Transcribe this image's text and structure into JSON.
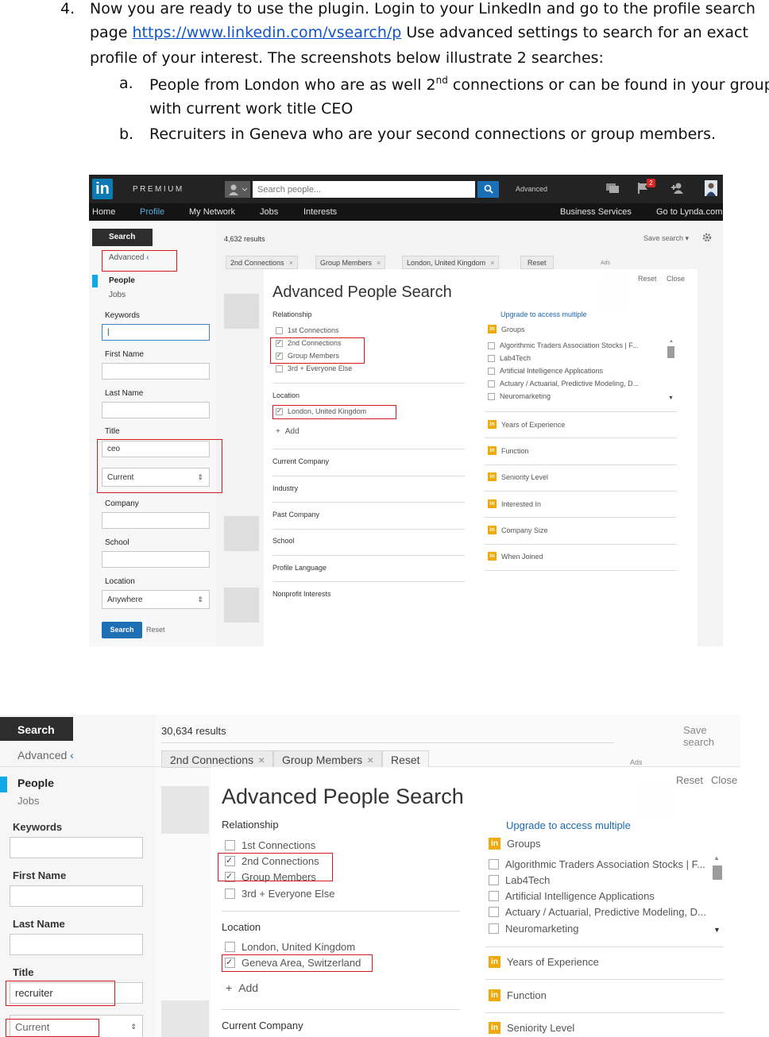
{
  "doc": {
    "item4_num": "4.",
    "item4_line1": "Now you are ready to use the plugin. Login to your LinkedIn and go to the profile search",
    "item4_line2_pre": "page ",
    "item4_link": "https://www.linkedin.com/vsearch/p",
    "item4_line2_post": "  Use advanced settings to search for an exact",
    "item4_line3": "profile of your interest. The screenshots below illustrate 2 searches:",
    "a_label": "a.",
    "a_line1_pre": "People from London who are as well 2",
    "a_sup": "nd",
    "a_line1_post": " connections or can be found in your groups",
    "a_line2": "with current work title CEO",
    "b_label": "b.",
    "b_line1": "Recruiters in Geneva who are your second connections or group members."
  },
  "shot1": {
    "topbar": {
      "logo": "in",
      "premium": "PREMIUM",
      "search_placeholder": "Search people...",
      "advanced": "Advanced",
      "notif_count": "2"
    },
    "nav": [
      "Home",
      "Profile",
      "My Network",
      "Jobs",
      "Interests",
      "Business Services",
      "Go to Lynda.com"
    ],
    "left": {
      "search_tab": "Search",
      "advanced": "Advanced",
      "advanced_chev": "‹",
      "people": "People",
      "jobs": "Jobs",
      "keywords": "Keywords",
      "keywords_value": "|",
      "first_name": "First Name",
      "last_name": "Last Name",
      "title": "Title",
      "title_value": "ceo",
      "title_scope": "Current",
      "company": "Company",
      "school": "School",
      "location": "Location",
      "location_value": "Anywhere",
      "search_btn": "Search",
      "reset": "Reset"
    },
    "results": {
      "count": "4,632 results",
      "save_search": "Save search",
      "filters": [
        "2nd Connections",
        "Group Members",
        "London, United Kingdom"
      ],
      "reset": "Reset",
      "ads": "Ads"
    },
    "modal": {
      "reset": "Reset",
      "close": "Close",
      "title": "Advanced People Search",
      "relationship": "Relationship",
      "rel_options": [
        {
          "label": "1st Connections",
          "checked": false
        },
        {
          "label": "2nd Connections",
          "checked": true
        },
        {
          "label": "Group Members",
          "checked": true
        },
        {
          "label": "3rd + Everyone Else",
          "checked": false
        }
      ],
      "location": "Location",
      "location_option": "London, United Kingdom",
      "add": "Add",
      "left_sections": [
        "Current Company",
        "Industry",
        "Past Company",
        "School",
        "Profile Language",
        "Nonprofit Interests"
      ],
      "upgrade": "Upgrade to access multiple",
      "groups": "Groups",
      "group_options": [
        "Algorithmic Traders Association Stocks | F...",
        "Lab4Tech",
        "Artificial Intelligence Applications",
        "Actuary / Actuarial, Predictive Modeling, D...",
        "Neuromarketing"
      ],
      "right_sections": [
        "Years of Experience",
        "Function",
        "Seniority Level",
        "Interested In",
        "Company Size",
        "When Joined"
      ]
    }
  },
  "shot2": {
    "left": {
      "search_tab": "Search",
      "advanced": "Advanced",
      "advanced_chev": "‹",
      "people": "People",
      "jobs": "Jobs",
      "keywords": "Keywords",
      "first_name": "First Name",
      "last_name": "Last Name",
      "title": "Title",
      "title_value": "recruiter",
      "title_scope": "Current"
    },
    "results": {
      "count": "30,634 results",
      "save_search": "Save search",
      "filters": [
        "2nd Connections",
        "Group Members"
      ],
      "reset": "Reset",
      "ads": "Ads"
    },
    "modal": {
      "reset": "Reset",
      "close": "Close",
      "title": "Advanced People Search",
      "relationship": "Relationship",
      "rel_options": [
        {
          "label": "1st Connections",
          "checked": false
        },
        {
          "label": "2nd Connections",
          "checked": true
        },
        {
          "label": "Group Members",
          "checked": true
        },
        {
          "label": "3rd + Everyone Else",
          "checked": false
        }
      ],
      "location": "Location",
      "loc_options": [
        {
          "label": "London, United Kingdom",
          "checked": false
        },
        {
          "label": "Geneva Area, Switzerland",
          "checked": true
        }
      ],
      "add": "Add",
      "current_company": "Current Company",
      "upgrade": "Upgrade to access multiple",
      "groups": "Groups",
      "group_options": [
        "Algorithmic Traders Association Stocks | F...",
        "Lab4Tech",
        "Artificial Intelligence Applications",
        "Actuary / Actuarial, Predictive Modeling, D...",
        "Neuromarketing"
      ],
      "right_sections": [
        "Years of Experience",
        "Function",
        "Seniority Level"
      ]
    }
  }
}
